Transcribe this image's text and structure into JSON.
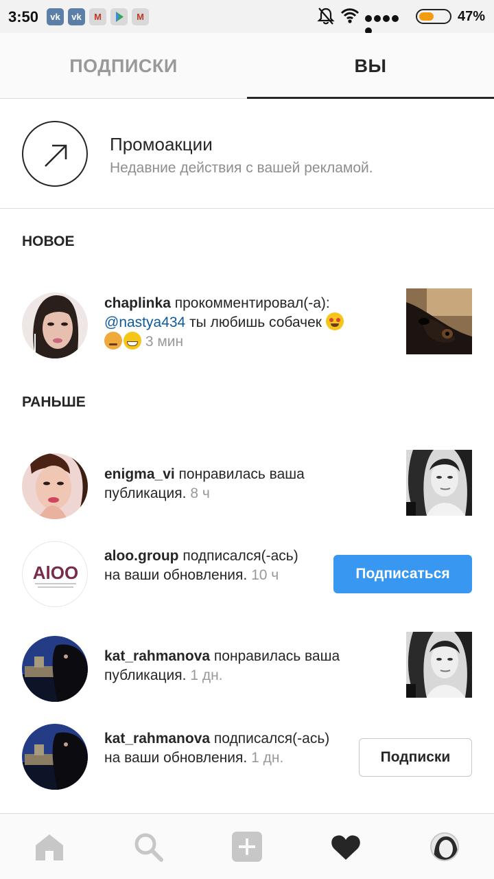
{
  "status_bar": {
    "time": "3:50",
    "notification_icons": [
      "vk-icon",
      "vk-icon",
      "gmail-icon",
      "play-store-icon",
      "gmail-icon"
    ],
    "battery_percent": "47%",
    "battery_level": 0.47,
    "accent_color": "#f39c12"
  },
  "tabs": {
    "following_label": "ПОДПИСКИ",
    "you_label": "ВЫ",
    "active": "you"
  },
  "promo": {
    "title": "Промоакции",
    "subtitle": "Недавние действия с вашей рекламой."
  },
  "sections": {
    "new_label": "НОВОЕ",
    "earlier_label": "РАНЬШЕ"
  },
  "notifications": [
    {
      "username": "chaplinka",
      "action": " прокомментировал(-а):",
      "mention": "@nastya434",
      "comment": " ты любишь собачек",
      "time": "3 мин"
    },
    {
      "username": "enigma_vi",
      "action": " понравилась ваша публикация.",
      "time": "8 ч"
    },
    {
      "username": "aloo.group",
      "action": " подписался(-ась) на ваши обновления.",
      "time": "10 ч",
      "button_label": "Подписаться",
      "avatar_text": "AlOO"
    },
    {
      "username": "kat_rahmanova",
      "action": " понравилась ваша публикация.",
      "time": "1 дн."
    },
    {
      "username": "kat_rahmanova",
      "action": " подписался(-ась) на ваши обновления.",
      "time": "1 дн.",
      "button_label": "Подписки"
    }
  ],
  "colors": {
    "follow_button": "#3897f0",
    "mention_link": "#0e5a9c",
    "muted_text": "#999999"
  }
}
